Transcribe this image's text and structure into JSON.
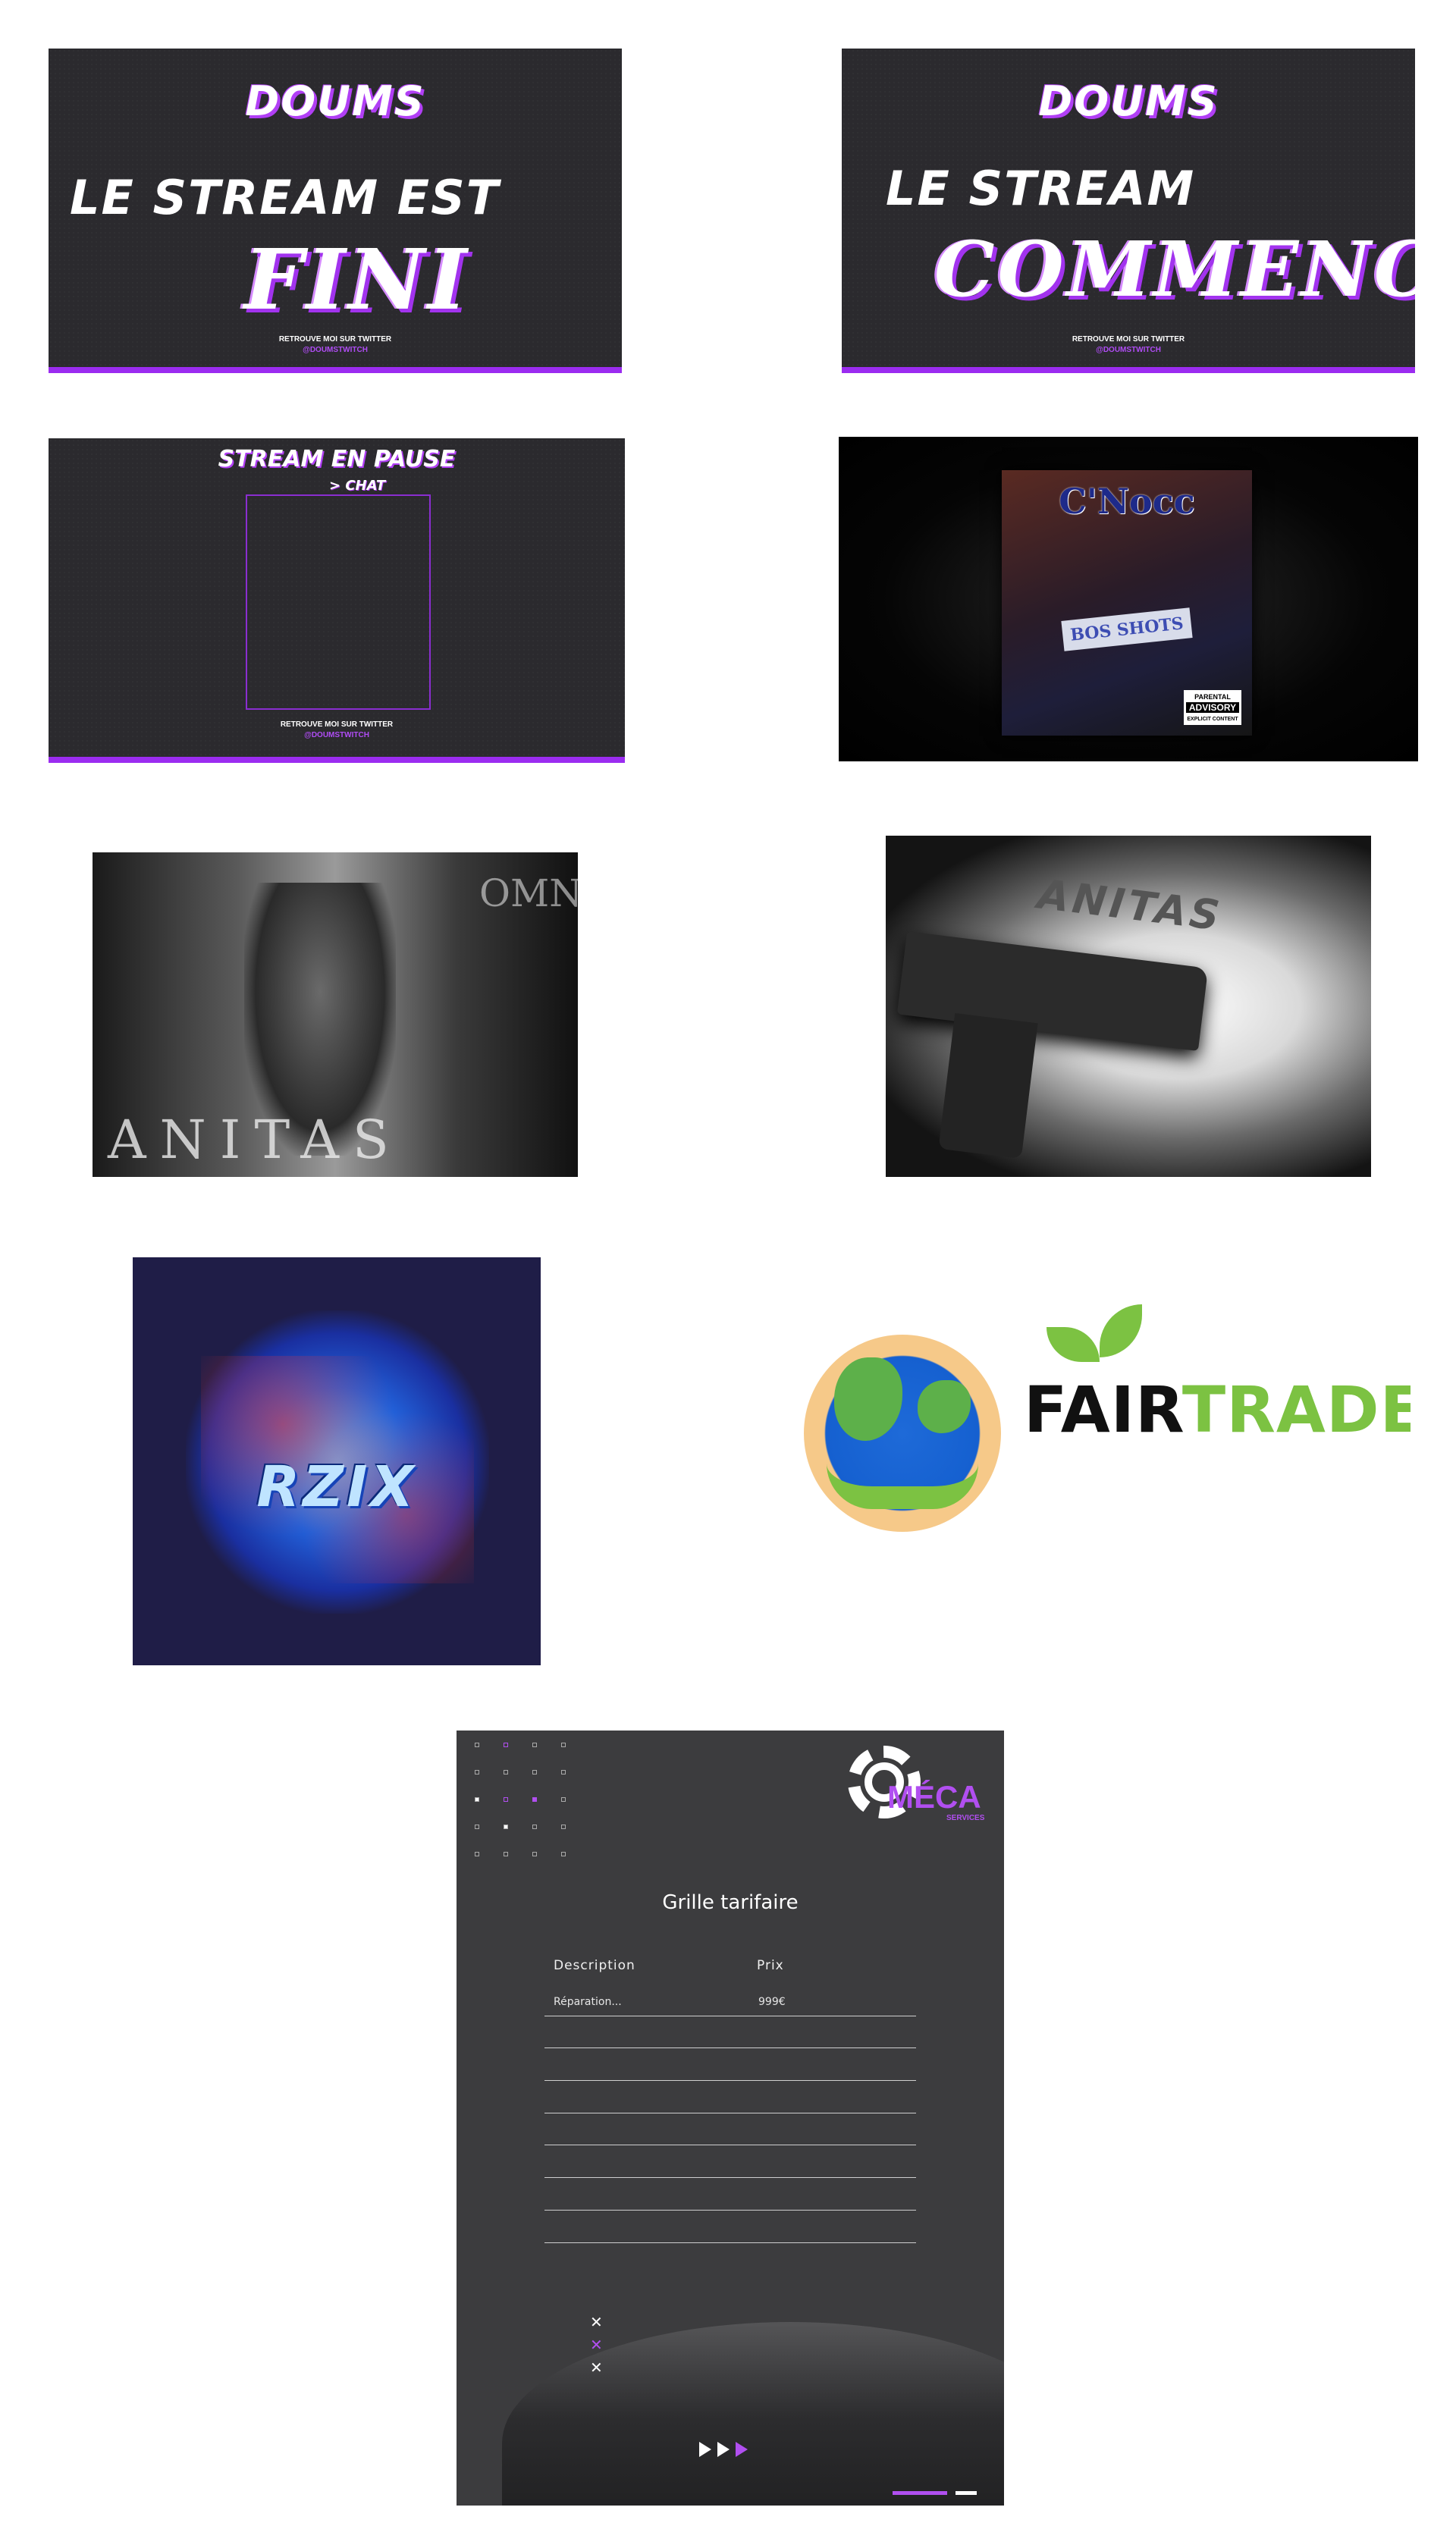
{
  "stream_end": {
    "brand": "DOUMS",
    "headline": "LE STREAM EST",
    "word": "FINI",
    "footer": "RETROUVE MOI SUR TWITTER",
    "handle": "@DOUMSTWITCH"
  },
  "stream_start": {
    "brand": "DOUMS",
    "headline": "LE STREAM",
    "word": "COMMENCE",
    "footer": "RETROUVE MOI SUR TWITTER",
    "handle": "@DOUMSTWITCH"
  },
  "stream_pause": {
    "title": "STREAM EN PAUSE",
    "chat_label": "> CHAT",
    "footer": "RETROUVE MOI SUR TWITTER",
    "handle": "@DOUMSTWITCH"
  },
  "album_cnocc": {
    "title": "C'Nocc",
    "banner": "BOS SHOTS",
    "advisory_top": "PARENTAL",
    "advisory_mid": "ADVISORY",
    "advisory_bottom": "EXPLICIT CONTENT"
  },
  "album_anitas_photo": {
    "word": "ANITAS",
    "vertical": "OMNIA"
  },
  "album_anitas_gun": {
    "word": "ANITAS"
  },
  "logo_rzix": {
    "word": "RZIX"
  },
  "logo_fairtrade": {
    "part1": "FAIR",
    "part2": "TRADE"
  },
  "price_sheet": {
    "logo_name": "MÉCA",
    "logo_sub": "SERVICES",
    "title": "Grille tarifaire",
    "col_description": "Description",
    "col_price": "Prix",
    "row1_description": "Réparation...",
    "row1_price": "999€"
  },
  "colors": {
    "accent_purple": "#9b2cf0",
    "fairtrade_green": "#7cc242"
  }
}
